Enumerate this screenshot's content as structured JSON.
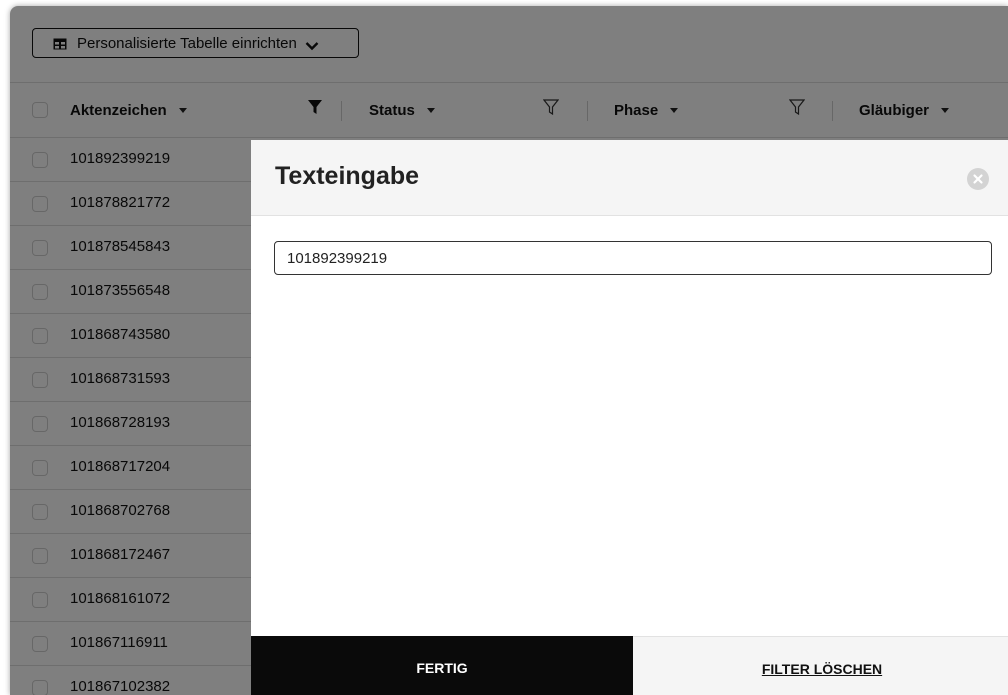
{
  "toolbar": {
    "configure_table_label": "Personalisierte Tabelle einrichten"
  },
  "table": {
    "columns": [
      {
        "label": "Aktenzeichen"
      },
      {
        "label": "Status"
      },
      {
        "label": "Phase"
      },
      {
        "label": "Gläubiger"
      }
    ],
    "rows": [
      "101892399219",
      "101878821772",
      "101878545843",
      "101873556548",
      "101868743580",
      "101868731593",
      "101868728193",
      "101868717204",
      "101868702768",
      "101868172467",
      "101868161072",
      "101867116911",
      "101867102382"
    ]
  },
  "modal": {
    "title": "Texteingabe",
    "input_value": "101892399219",
    "done_label": "FERTIG",
    "clear_label": "FILTER LÖSCHEN"
  }
}
